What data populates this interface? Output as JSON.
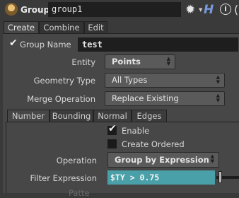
{
  "header": {
    "node_type": "Group",
    "node_name": "group1",
    "help_label": "H",
    "info_label": "i"
  },
  "tabs": [
    "Create",
    "Combine",
    "Edit"
  ],
  "create": {
    "group_name_label": "Group Name",
    "group_name_value": "test",
    "group_name_checked": true,
    "entity_label": "Entity",
    "entity_value": "Points",
    "geometry_type_label": "Geometry Type",
    "geometry_type_value": "All Types",
    "merge_operation_label": "Merge Operation",
    "merge_operation_value": "Replace Existing"
  },
  "subtabs": [
    "Number",
    "Bounding",
    "Normal",
    "Edges"
  ],
  "number": {
    "enable_label": "Enable",
    "enable_checked": true,
    "create_ordered_label": "Create Ordered",
    "create_ordered_checked": false,
    "operation_label": "Operation",
    "operation_value": "Group by Expression",
    "filter_expression_label": "Filter Expression",
    "filter_expression_value": "$TY > 0.75",
    "next_label_partial": "Patte"
  },
  "colors": {
    "expression_field": "#4aa0a8",
    "help_icon": "#7a9ae0"
  },
  "icons": [
    "node-group-icon",
    "gear-icon",
    "help-icon",
    "info-icon",
    "checkmark-icon",
    "dropdown-arrows-icon"
  ]
}
